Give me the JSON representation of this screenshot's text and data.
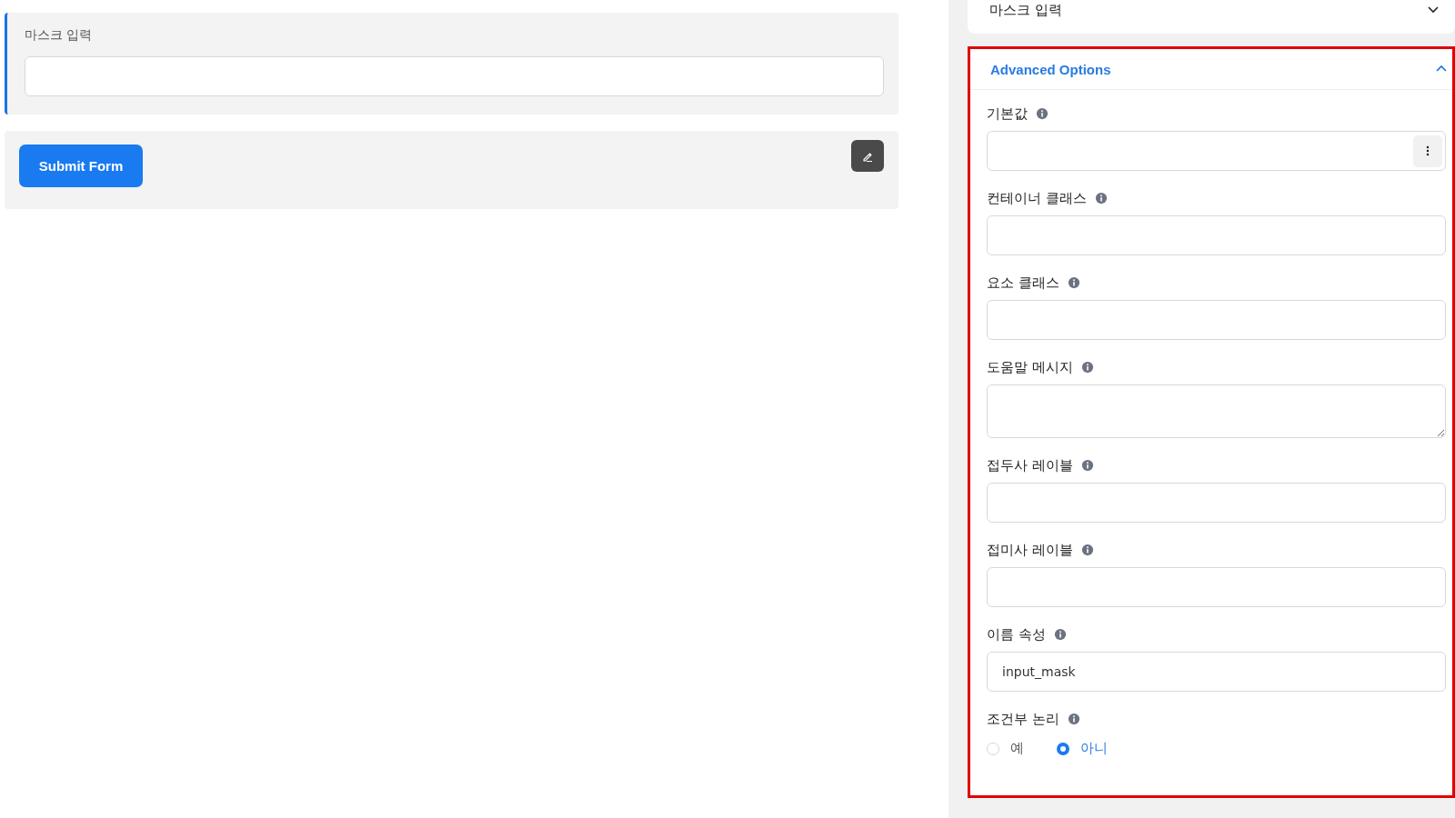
{
  "form_preview": {
    "field": {
      "label": "마스크 입력",
      "selected": true
    },
    "submit_button": "Submit Form"
  },
  "settings": {
    "collapsed_section": {
      "title": "마스크 입력",
      "expanded": false
    },
    "advanced_section": {
      "title": "Advanced Options",
      "expanded": true,
      "highlighted": true,
      "fields": [
        {
          "kind": "input-menu",
          "label": "기본값"
        },
        {
          "kind": "input",
          "label": "컨테이너 클래스"
        },
        {
          "kind": "input",
          "label": "요소 클래스"
        },
        {
          "kind": "textarea",
          "label": "도움말 메시지"
        },
        {
          "kind": "input",
          "label": "접두사 레이블"
        },
        {
          "kind": "input",
          "label": "접미사 레이블"
        },
        {
          "kind": "input",
          "label": "이름 속성",
          "value": "input_mask"
        },
        {
          "kind": "radio",
          "label": "조건부 논리",
          "options": [
            {
              "label": "예",
              "selected": false
            },
            {
              "label": "아니",
              "selected": true
            }
          ]
        }
      ]
    }
  }
}
